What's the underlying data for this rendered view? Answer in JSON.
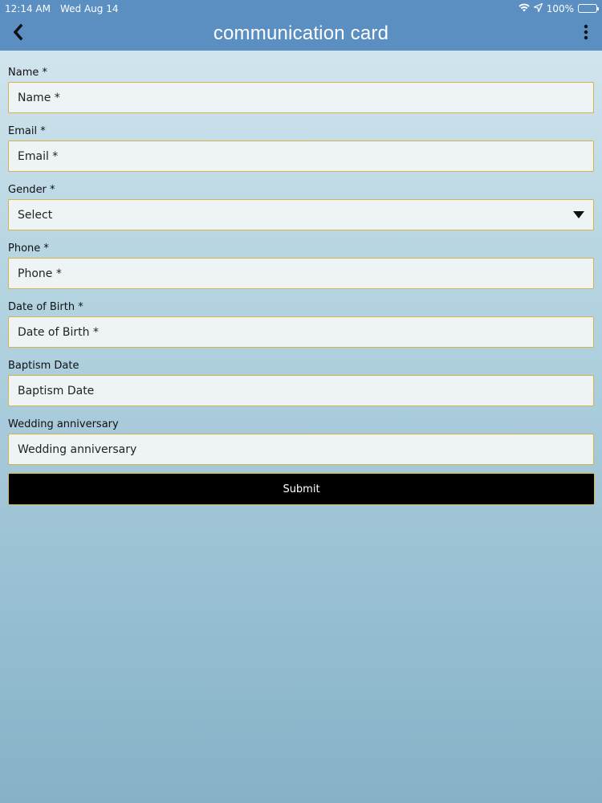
{
  "status_bar": {
    "time": "12:14 AM",
    "date": "Wed Aug 14",
    "battery": "100%",
    "icons": [
      "wifi-icon",
      "location-arrow-icon",
      "battery-icon"
    ]
  },
  "nav": {
    "title": "communication card",
    "back_icon": "chevron-left-icon",
    "menu_icon": "more-vertical-icon"
  },
  "form": {
    "name": {
      "label": "Name *",
      "placeholder": "Name *"
    },
    "email": {
      "label": "Email *",
      "placeholder": "Email *"
    },
    "gender": {
      "label": "Gender *",
      "value": "Select"
    },
    "phone": {
      "label": "Phone *",
      "placeholder": "Phone *"
    },
    "dob": {
      "label": "Date of Birth *",
      "placeholder": "Date of Birth *"
    },
    "baptism": {
      "label": "Baptism Date",
      "placeholder": "Baptism Date"
    },
    "wedding": {
      "label": "Wedding anniversary",
      "placeholder": "Wedding anniversary"
    },
    "submit_label": "Submit"
  },
  "colors": {
    "header": "#5b8fc1",
    "field_border": "#d4b34a",
    "field_bg": "#eef4f6",
    "submit_bg": "#000000"
  }
}
